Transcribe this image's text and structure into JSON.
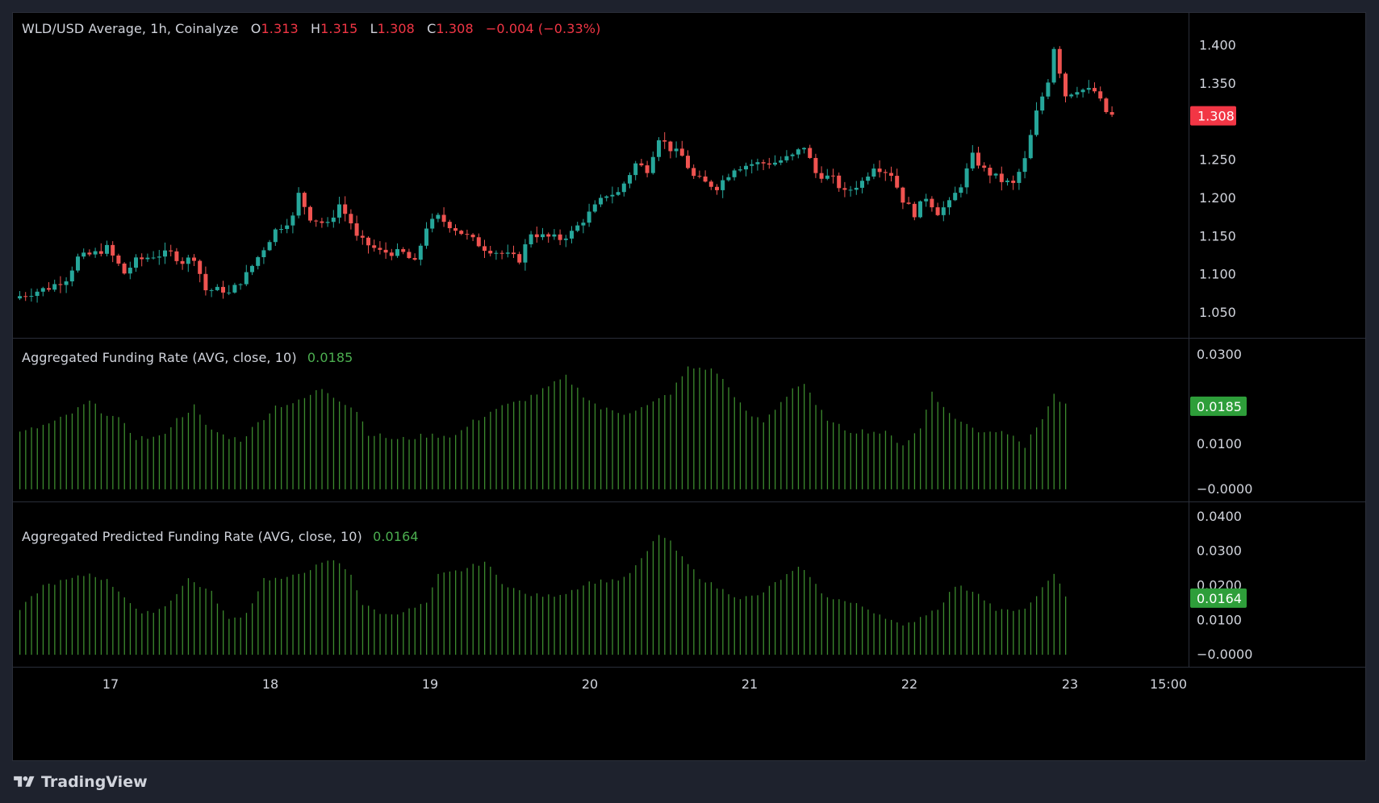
{
  "header": {
    "symbol": "WLD/USD Average, 1h, Coinalyze",
    "o_label": "O",
    "o_value": "1.313",
    "h_label": "H",
    "h_value": "1.315",
    "l_label": "L",
    "l_value": "1.308",
    "c_label": "C",
    "c_value": "1.308",
    "change": "−0.004 (−0.33%)"
  },
  "funding": {
    "label": "Aggregated Funding Rate (AVG, close, 10)",
    "value": "0.0185"
  },
  "predicted": {
    "label": "Aggregated Predicted Funding Rate (AVG, close, 10)",
    "value": "0.0164"
  },
  "brand": "TradingView",
  "colors": {
    "up": "#26a69a",
    "down": "#ef5350",
    "hist": "#3c8a2e",
    "badge_price": "#f23645",
    "badge_rate": "#2e9e3a"
  },
  "chart_data": [
    {
      "type": "candlestick",
      "title": "WLD/USD Average, 1h, Coinalyze",
      "x_ticks": [
        "17",
        "18",
        "19",
        "20",
        "21",
        "22",
        "23",
        "15:00"
      ],
      "y_ticks": [
        "1.400",
        "1.350",
        "1.250",
        "1.200",
        "1.150",
        "1.100",
        "1.050"
      ],
      "ylim": [
        1.03,
        1.43
      ],
      "last_price": "1.308",
      "anchors": [
        [
          0,
          1.072
        ],
        [
          5,
          1.083
        ],
        [
          8,
          1.095
        ],
        [
          10,
          1.122
        ],
        [
          13,
          1.128
        ],
        [
          15,
          1.135
        ],
        [
          18,
          1.102
        ],
        [
          20,
          1.118
        ],
        [
          23,
          1.125
        ],
        [
          26,
          1.128
        ],
        [
          28,
          1.117
        ],
        [
          30,
          1.123
        ],
        [
          32,
          1.08
        ],
        [
          35,
          1.08
        ],
        [
          36,
          1.075
        ],
        [
          39,
          1.1
        ],
        [
          41,
          1.123
        ],
        [
          44,
          1.158
        ],
        [
          47,
          1.175
        ],
        [
          48,
          1.205
        ],
        [
          50,
          1.175
        ],
        [
          53,
          1.165
        ],
        [
          55,
          1.192
        ],
        [
          57,
          1.168
        ],
        [
          58,
          1.148
        ],
        [
          62,
          1.13
        ],
        [
          66,
          1.128
        ],
        [
          68,
          1.115
        ],
        [
          70,
          1.163
        ],
        [
          72,
          1.175
        ],
        [
          76,
          1.155
        ],
        [
          80,
          1.135
        ],
        [
          84,
          1.125
        ],
        [
          86,
          1.12
        ],
        [
          88,
          1.155
        ],
        [
          90,
          1.15
        ],
        [
          93,
          1.147
        ],
        [
          95,
          1.155
        ],
        [
          98,
          1.18
        ],
        [
          101,
          1.205
        ],
        [
          103,
          1.207
        ],
        [
          106,
          1.245
        ],
        [
          108,
          1.238
        ],
        [
          110,
          1.28
        ],
        [
          112,
          1.265
        ],
        [
          114,
          1.255
        ],
        [
          116,
          1.228
        ],
        [
          118,
          1.22
        ],
        [
          120,
          1.215
        ],
        [
          123,
          1.24
        ],
        [
          126,
          1.245
        ],
        [
          130,
          1.247
        ],
        [
          133,
          1.255
        ],
        [
          135,
          1.268
        ],
        [
          137,
          1.233
        ],
        [
          140,
          1.225
        ],
        [
          142,
          1.207
        ],
        [
          145,
          1.222
        ],
        [
          147,
          1.243
        ],
        [
          150,
          1.232
        ],
        [
          152,
          1.198
        ],
        [
          154,
          1.18
        ],
        [
          156,
          1.202
        ],
        [
          158,
          1.182
        ],
        [
          160,
          1.193
        ],
        [
          162,
          1.218
        ],
        [
          164,
          1.255
        ],
        [
          166,
          1.237
        ],
        [
          169,
          1.223
        ],
        [
          171,
          1.218
        ],
        [
          173,
          1.25
        ],
        [
          175,
          1.312
        ],
        [
          177,
          1.355
        ],
        [
          178,
          1.398
        ],
        [
          180,
          1.335
        ],
        [
          182,
          1.343
        ],
        [
          185,
          1.34
        ],
        [
          187,
          1.313
        ],
        [
          188,
          1.308
        ]
      ],
      "candle_count": 189
    },
    {
      "type": "bar",
      "title": "Aggregated Funding Rate (AVG, close, 10)",
      "y_ticks": [
        "0.0300",
        "0.0100",
        "−0.0000"
      ],
      "ylim": [
        -0.0002,
        0.0305
      ],
      "last_value": "0.0185",
      "anchors": [
        [
          0,
          0.0125
        ],
        [
          6,
          0.015
        ],
        [
          9,
          0.017
        ],
        [
          12,
          0.0195
        ],
        [
          14,
          0.0175
        ],
        [
          17,
          0.0155
        ],
        [
          20,
          0.0115
        ],
        [
          24,
          0.0115
        ],
        [
          27,
          0.0155
        ],
        [
          30,
          0.0185
        ],
        [
          32,
          0.014
        ],
        [
          35,
          0.012
        ],
        [
          38,
          0.011
        ],
        [
          40,
          0.0135
        ],
        [
          44,
          0.0185
        ],
        [
          48,
          0.0195
        ],
        [
          52,
          0.0225
        ],
        [
          55,
          0.02
        ],
        [
          58,
          0.0175
        ],
        [
          60,
          0.0125
        ],
        [
          65,
          0.011
        ],
        [
          70,
          0.012
        ],
        [
          75,
          0.012
        ],
        [
          78,
          0.015
        ],
        [
          82,
          0.018
        ],
        [
          86,
          0.0195
        ],
        [
          90,
          0.022
        ],
        [
          94,
          0.025
        ],
        [
          97,
          0.021
        ],
        [
          100,
          0.018
        ],
        [
          104,
          0.017
        ],
        [
          108,
          0.0185
        ],
        [
          112,
          0.0215
        ],
        [
          115,
          0.027
        ],
        [
          118,
          0.027
        ],
        [
          120,
          0.026
        ],
        [
          123,
          0.021
        ],
        [
          125,
          0.017
        ],
        [
          128,
          0.015
        ],
        [
          131,
          0.0195
        ],
        [
          133,
          0.0225
        ],
        [
          135,
          0.0235
        ],
        [
          137,
          0.0185
        ],
        [
          140,
          0.0145
        ],
        [
          143,
          0.013
        ],
        [
          146,
          0.013
        ],
        [
          149,
          0.0125
        ],
        [
          152,
          0.01
        ],
        [
          155,
          0.0135
        ],
        [
          157,
          0.022
        ],
        [
          159,
          0.018
        ],
        [
          162,
          0.015
        ],
        [
          165,
          0.013
        ],
        [
          168,
          0.013
        ],
        [
          171,
          0.0125
        ],
        [
          173,
          0.0095
        ],
        [
          176,
          0.016
        ],
        [
          178,
          0.021
        ],
        [
          180,
          0.0185
        ]
      ],
      "bar_count": 181
    },
    {
      "type": "bar",
      "title": "Aggregated Predicted Funding Rate (AVG, close, 10)",
      "y_ticks": [
        "0.0400",
        "0.0300",
        "0.0200",
        "0.0100",
        "−0.0000"
      ],
      "ylim": [
        -0.0002,
        0.0402
      ],
      "last_value": "0.0164",
      "anchors": [
        [
          0,
          0.013
        ],
        [
          4,
          0.02
        ],
        [
          9,
          0.022
        ],
        [
          12,
          0.0235
        ],
        [
          15,
          0.0215
        ],
        [
          18,
          0.017
        ],
        [
          21,
          0.0115
        ],
        [
          25,
          0.014
        ],
        [
          29,
          0.022
        ],
        [
          33,
          0.018
        ],
        [
          36,
          0.01
        ],
        [
          39,
          0.012
        ],
        [
          42,
          0.022
        ],
        [
          46,
          0.022
        ],
        [
          50,
          0.025
        ],
        [
          54,
          0.0275
        ],
        [
          57,
          0.0235
        ],
        [
          59,
          0.0145
        ],
        [
          63,
          0.0115
        ],
        [
          67,
          0.013
        ],
        [
          70,
          0.015
        ],
        [
          72,
          0.023
        ],
        [
          76,
          0.0245
        ],
        [
          80,
          0.027
        ],
        [
          83,
          0.021
        ],
        [
          87,
          0.0175
        ],
        [
          91,
          0.017
        ],
        [
          94,
          0.018
        ],
        [
          98,
          0.021
        ],
        [
          101,
          0.0215
        ],
        [
          104,
          0.022
        ],
        [
          107,
          0.0275
        ],
        [
          110,
          0.035
        ],
        [
          112,
          0.0325
        ],
        [
          114,
          0.028
        ],
        [
          117,
          0.0225
        ],
        [
          120,
          0.0195
        ],
        [
          124,
          0.0165
        ],
        [
          127,
          0.017
        ],
        [
          131,
          0.022
        ],
        [
          134,
          0.025
        ],
        [
          136,
          0.023
        ],
        [
          138,
          0.0175
        ],
        [
          142,
          0.0155
        ],
        [
          145,
          0.014
        ],
        [
          149,
          0.011
        ],
        [
          152,
          0.008
        ],
        [
          155,
          0.011
        ],
        [
          158,
          0.0135
        ],
        [
          161,
          0.02
        ],
        [
          165,
          0.018
        ],
        [
          168,
          0.013
        ],
        [
          172,
          0.0125
        ],
        [
          175,
          0.0165
        ],
        [
          178,
          0.024
        ],
        [
          180,
          0.0164
        ]
      ],
      "bar_count": 181
    }
  ]
}
